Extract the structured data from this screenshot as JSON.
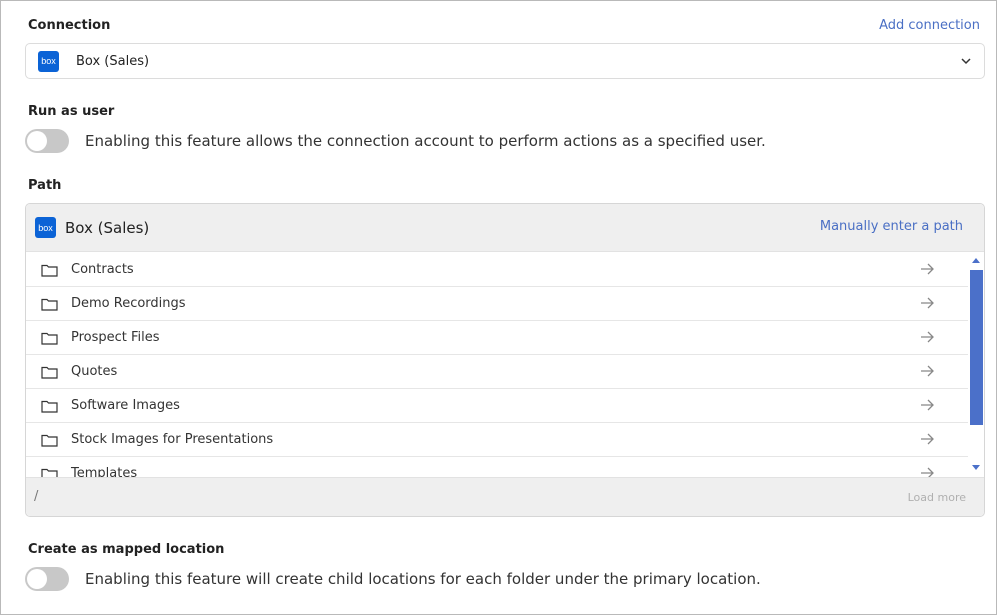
{
  "connection": {
    "label": "Connection",
    "add_link": "Add connection",
    "selected": "Box (Sales)",
    "logo_text": "box"
  },
  "run_as_user": {
    "label": "Run as user",
    "description": "Enabling this feature allows the connection account to perform actions as a specified user.",
    "enabled": false
  },
  "path": {
    "label": "Path",
    "title": "Box (Sales)",
    "manual_link": "Manually enter a path",
    "folders": [
      "Contracts",
      "Demo Recordings",
      "Prospect Files",
      "Quotes",
      "Software Images",
      "Stock Images for Presentations",
      "Templates"
    ],
    "current": "/",
    "load_more": "Load more"
  },
  "mapped": {
    "label": "Create as mapped location",
    "description": "Enabling this feature will create child locations for each folder under the primary location.",
    "enabled": false
  },
  "colors": {
    "accent": "#4a6fc4",
    "box_brand": "#0b63d6",
    "scrollbar": "#4b70c9"
  }
}
